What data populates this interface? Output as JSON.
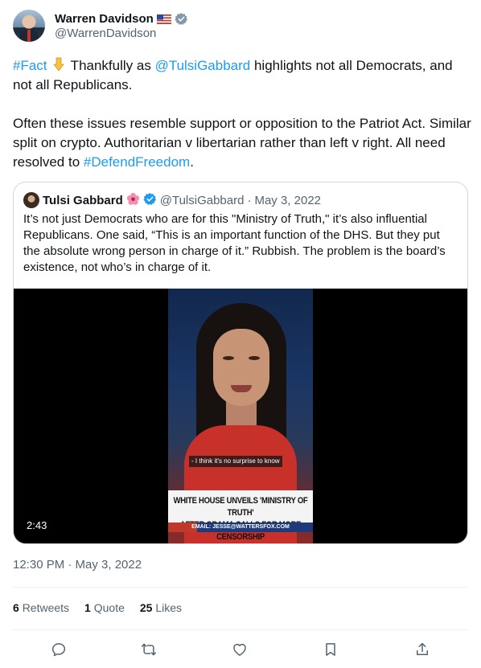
{
  "author": {
    "display_name": "Warren Davidson",
    "handle": "@WarrenDavidson"
  },
  "tweet": {
    "hashtag_fact": "#Fact",
    "pointing_emoji": "pointing-down-emoji",
    "text_1": " Thankfully as ",
    "mention": "@TulsiGabbard",
    "text_2": " highlights not all Democrats, and not all Republicans.",
    "text_3": "Often these issues resemble support or opposition to the Patriot Act. Similar split on crypto. Authoritarian v libertarian rather than left v right. All need resolved to ",
    "hashtag_defend": "#DefendFreedom",
    "text_4": "."
  },
  "quoted_tweet": {
    "display_name": "Tulsi Gabbard",
    "handle": "@TulsiGabbard",
    "separator": "·",
    "date": "May 3, 2022",
    "text": "It’s not just Democrats who are for this \"Ministry of Truth,\" it’s also influential Republicans. One said, “This is an important function of the DHS. But they put the absolute wrong person in charge of it.” Rubbish. The problem is the board’s existence, not who’s in charge of it.",
    "video": {
      "subtitle": "- I think it's no surprise to know",
      "chyron_line_1": "WHITE HOUSE UNVEILS 'MINISTRY OF TRUTH'",
      "chyron_line_2": "AFTER OBAMA CALLS FOR MORE CENSORSHIP",
      "ticker": "EMAIL: JESSE@WATTERSFOX.COM",
      "duration": "2:43"
    }
  },
  "timestamp": "12:30 PM · May 3, 2022",
  "stats": {
    "retweets_count": "6",
    "retweets_label": "Retweets",
    "quotes_count": "1",
    "quotes_label": "Quote",
    "likes_count": "25",
    "likes_label": "Likes"
  },
  "colors": {
    "link": "#1d9bf0",
    "secondary_text": "#536471",
    "border": "#cfd9de",
    "verified": "#1d9bf0"
  },
  "icons": [
    "reply-icon",
    "retweet-icon",
    "like-icon",
    "bookmark-icon",
    "share-icon"
  ]
}
